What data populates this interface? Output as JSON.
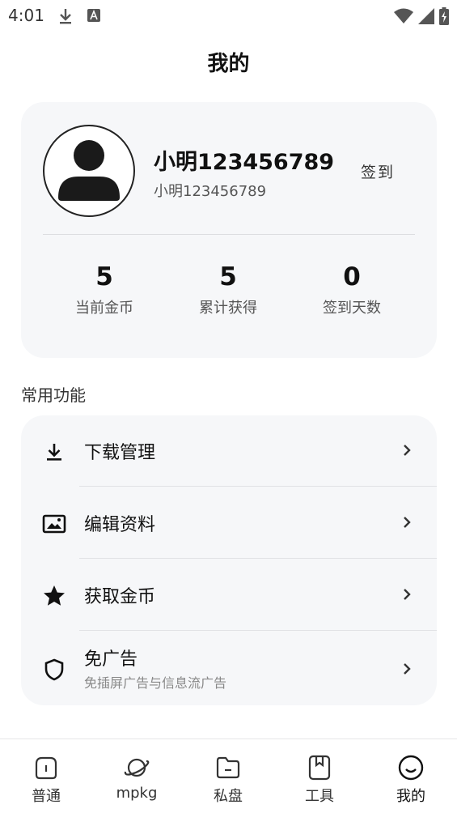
{
  "status_bar": {
    "time": "4:01"
  },
  "header": {
    "title": "我的"
  },
  "profile": {
    "name": "小明123456789",
    "subtitle": "小明123456789",
    "signin_label": "签到",
    "stats": [
      {
        "value": "5",
        "label": "当前金币"
      },
      {
        "value": "5",
        "label": "累计获得"
      },
      {
        "value": "0",
        "label": "签到天数"
      }
    ]
  },
  "section": {
    "title": "常用功能"
  },
  "menu": {
    "items": [
      {
        "label": "下载管理",
        "icon": "download-icon"
      },
      {
        "label": "编辑资料",
        "icon": "image-edit-icon"
      },
      {
        "label": "获取金币",
        "icon": "star-icon"
      },
      {
        "label": "免广告",
        "sublabel": "免插屏广告与信息流广告",
        "icon": "shield-icon"
      }
    ]
  },
  "bottom_nav": {
    "items": [
      {
        "label": "普通",
        "icon": "normal-icon"
      },
      {
        "label": "mpkg",
        "icon": "planet-icon"
      },
      {
        "label": "私盘",
        "icon": "folder-icon"
      },
      {
        "label": "工具",
        "icon": "bookmark-box-icon"
      },
      {
        "label": "我的",
        "icon": "smile-icon"
      }
    ],
    "active": "我的"
  },
  "colors": {
    "card_bg": "#f6f7f9",
    "text": "#111111",
    "muted": "#555555"
  }
}
